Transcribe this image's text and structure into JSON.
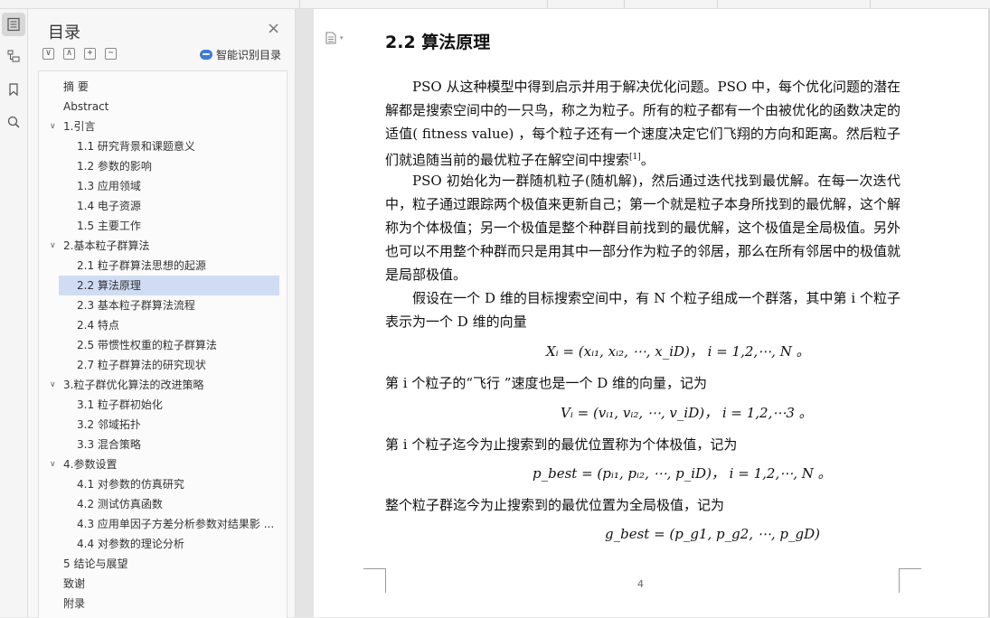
{
  "sidebar": {
    "title": "目录",
    "close_glyph": "×",
    "tools": [
      "∨",
      "∧",
      "+",
      "−"
    ],
    "smart_label": "智能识别目录",
    "items": [
      {
        "label": "摘  要",
        "level": 0,
        "arrow": ""
      },
      {
        "label": "Abstract",
        "level": 0,
        "arrow": ""
      },
      {
        "label": "1.引言",
        "level": 0,
        "arrow": "∨"
      },
      {
        "label": "1.1  研究背景和课题意义",
        "level": 1,
        "arrow": ""
      },
      {
        "label": "1.2  参数的影响",
        "level": 1,
        "arrow": ""
      },
      {
        "label": "1.3  应用领域",
        "level": 1,
        "arrow": ""
      },
      {
        "label": "1.4  电子资源",
        "level": 1,
        "arrow": ""
      },
      {
        "label": "1.5  主要工作",
        "level": 1,
        "arrow": ""
      },
      {
        "label": "2.基本粒子群算法",
        "level": 0,
        "arrow": "∨"
      },
      {
        "label": "2.1  粒子群算法思想的起源",
        "level": 1,
        "arrow": ""
      },
      {
        "label": "2.2  算法原理",
        "level": 1,
        "arrow": "",
        "selected": true
      },
      {
        "label": "2.3  基本粒子群算法流程",
        "level": 1,
        "arrow": ""
      },
      {
        "label": "2.4  特点",
        "level": 1,
        "arrow": ""
      },
      {
        "label": "2.5  带惯性权重的粒子群算法",
        "level": 1,
        "arrow": ""
      },
      {
        "label": "2.7  粒子群算法的研究现状",
        "level": 1,
        "arrow": ""
      },
      {
        "label": "3.粒子群优化算法的改进策略",
        "level": 0,
        "arrow": "∨"
      },
      {
        "label": "3.1  粒子群初始化",
        "level": 1,
        "arrow": ""
      },
      {
        "label": "3.2  邻域拓扑",
        "level": 1,
        "arrow": ""
      },
      {
        "label": "3.3  混合策略",
        "level": 1,
        "arrow": ""
      },
      {
        "label": "4.参数设置",
        "level": 0,
        "arrow": "∨"
      },
      {
        "label": "4.1  对参数的仿真研究",
        "level": 1,
        "arrow": ""
      },
      {
        "label": "4.2  测试仿真函数",
        "level": 1,
        "arrow": ""
      },
      {
        "label": "4.3  应用单因子方差分析参数对结果影 ...",
        "level": 1,
        "arrow": ""
      },
      {
        "label": "4.4  对参数的理论分析",
        "level": 1,
        "arrow": ""
      },
      {
        "label": "5 结论与展望",
        "level": 0,
        "arrow": ""
      },
      {
        "label": "致谢",
        "level": 0,
        "arrow": ""
      },
      {
        "label": "附录",
        "level": 0,
        "arrow": ""
      }
    ]
  },
  "document": {
    "heading": "2.2  算法原理",
    "para1": "PSO 从这种模型中得到启示并用于解决优化问题。PSO 中，每个优化问题的潜在解都是搜索空间中的一只鸟，称之为粒子。所有的粒子都有一个由被优化的函数决定的适值( fitness value) ，每个粒子还有一个速度决定它们飞翔的方向和距离。然后粒子们就追随当前的最优粒子在解空间中搜索",
    "para1_ref": "[1]",
    "para1_end": "。",
    "para2": "PSO 初始化为一群随机粒子(随机解)，然后通过迭代找到最优解。在每一次迭代中，粒子通过跟踪两个极值来更新自己；第一个就是粒子本身所找到的最优解，这个解称为个体极值；另一个极值是整个种群目前找到的最优解，这个极值是全局极值。另外也可以不用整个种群而只是用其中一部分作为粒子的邻居，那么在所有邻居中的极值就是局部极值。",
    "para3": "假设在一个 D 维的目标搜索空间中，有 N 个粒子组成一个群落，其中第 i 个粒子表示为一个 D 维的向量",
    "formula1": "Xᵢ = (xᵢ₁, xᵢ₂, ⋯, x_iD)，  i = 1,2,⋯, N 。",
    "line2": "第 i 个粒子的“飞行  ”速度也是一个 D 维的向量，记为",
    "formula2": "Vᵢ = (vᵢ₁, vᵢ₂, ⋯, v_iD)，  i = 1,2,⋯3 。",
    "line3": "第 i 个粒子迄今为止搜索到的最优位置称为个体极值，记为",
    "formula3": "p_best = (pᵢ₁, pᵢ₂, ⋯, p_iD)，  i = 1,2,⋯, N 。",
    "line4": "整个粒子群迄今为止搜索到的最优位置为全局极值，记为",
    "formula4": "g_best = (p_g1, p_g2, ⋯, p_gD)",
    "page_number": "4"
  }
}
